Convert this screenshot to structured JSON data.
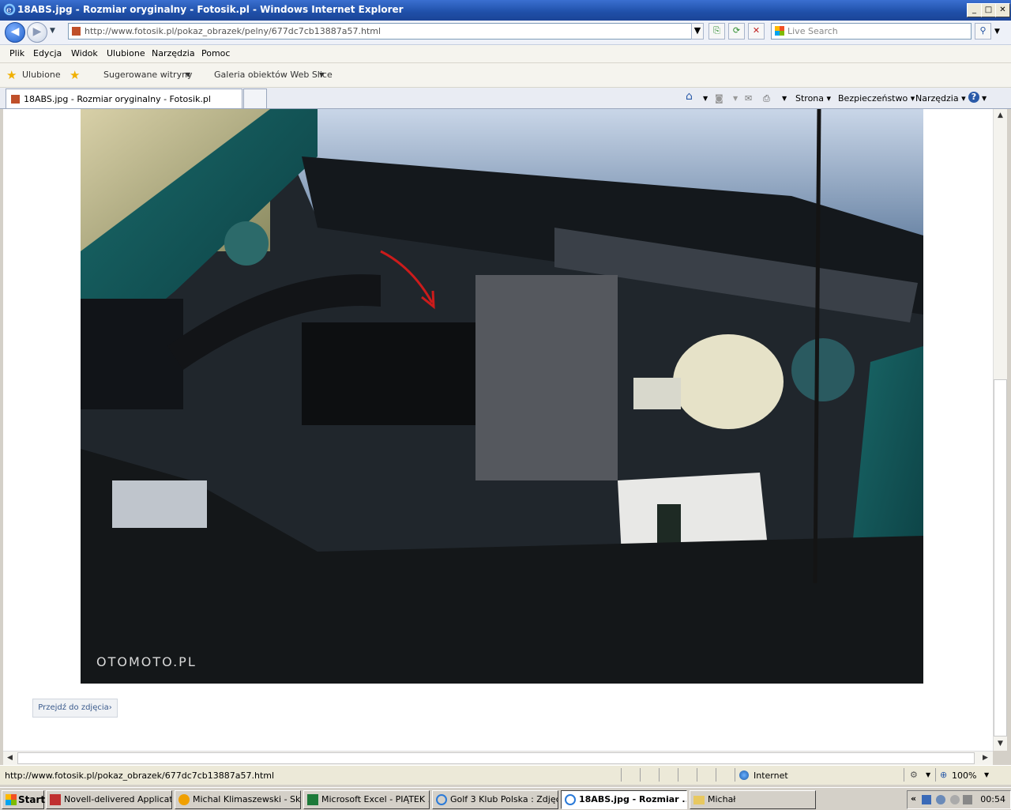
{
  "window": {
    "title": "18ABS.jpg - Rozmiar oryginalny - Fotosik.pl - Windows Internet Explorer"
  },
  "address": {
    "url": "http://www.fotosik.pl/pokaz_obrazek/pelny/677dc7cb13887a57.html"
  },
  "search": {
    "placeholder": "Live Search"
  },
  "menu": [
    "Plik",
    "Edycja",
    "Widok",
    "Ulubione",
    "Narzędzia",
    "Pomoc"
  ],
  "favorites_bar": {
    "favorites": "Ulubione",
    "suggested": "Sugerowane witryny",
    "gallery": "Galeria obiektów Web Slice"
  },
  "tabs": [
    {
      "label": "18ABS.jpg - Rozmiar oryginalny - Fotosik.pl"
    }
  ],
  "commandbar": {
    "page": "Strona",
    "safety": "Bezpieczeństwo",
    "tools": "Narzędzia"
  },
  "content": {
    "photo_watermark": "OTOMOTO.PL",
    "goto_photo": "Przejdź do zdjęcia"
  },
  "status": {
    "text": "http://www.fotosik.pl/pokaz_obrazek/677dc7cb13887a57.html",
    "zone": "Internet",
    "zoom": "100%"
  },
  "taskbar": {
    "start": "Start",
    "tasks": [
      "Novell-delivered Applicati...",
      "Michal Klimaszewski - Skr...",
      "Microsoft Excel - PIĄTEK ...",
      "Golf 3 Klub Polska : Zdjęc...",
      "18ABS.jpg - Rozmiar ...",
      "Michał"
    ],
    "clock": "00:54",
    "chevron": "«"
  }
}
